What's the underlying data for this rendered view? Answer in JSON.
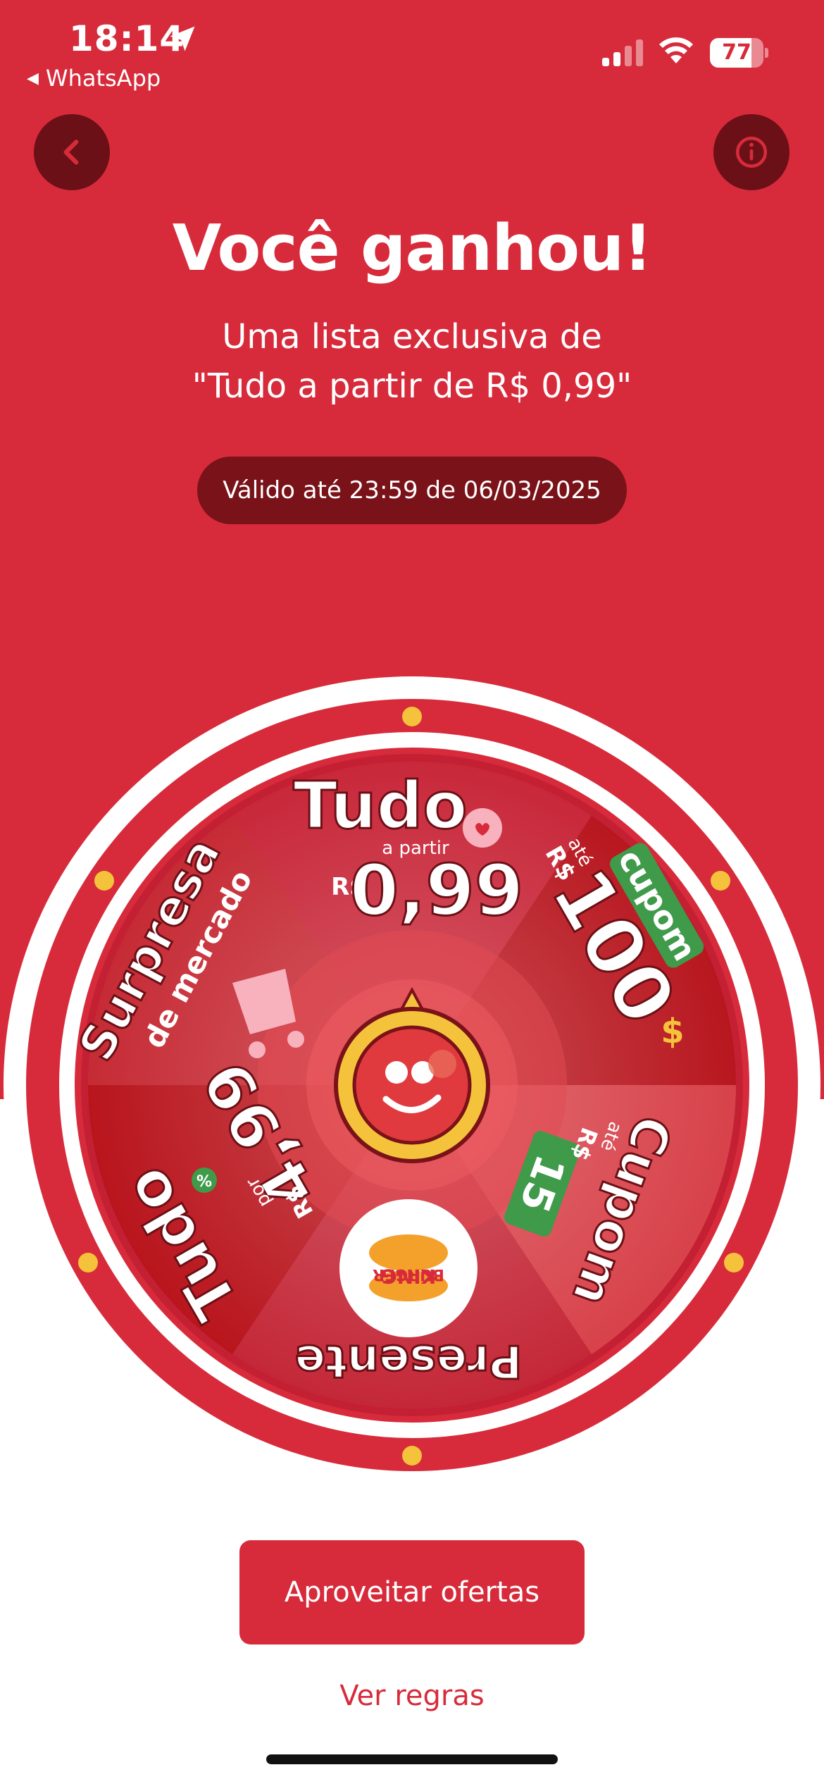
{
  "status_bar": {
    "time": "18:14",
    "back_app": "WhatsApp",
    "battery": "77",
    "battery_level": 0.77
  },
  "header": {
    "headline": "Você ganhou!",
    "subtitle_line1": "Uma lista exclusiva de",
    "subtitle_line2": "\"Tudo a partir de R$ 0,99\"",
    "validity": "Válido até 23:59 de 06/03/2025"
  },
  "wheel": {
    "segments": [
      {
        "title": "Tudo",
        "sub": "a partir",
        "prefix": "R$",
        "value": "0,99"
      },
      {
        "badge": "cupom",
        "sub": "até",
        "prefix": "R$",
        "value": "100"
      },
      {
        "title": "Cupom",
        "sub": "até",
        "prefix": "R$",
        "value": "15"
      },
      {
        "title": "Presente",
        "logo_top": "BURGER",
        "logo_bottom": "KING"
      },
      {
        "title": "Tudo",
        "sub": "por",
        "prefix": "R$",
        "value": "4,99"
      },
      {
        "title": "Surpresa",
        "sub": "de mercado"
      }
    ]
  },
  "actions": {
    "primary": "Aproveitar ofertas",
    "secondary": "Ver regras"
  },
  "colors": {
    "brand": "#d72b3b",
    "dark": "#7a1219",
    "green": "#3f9a4a",
    "gold": "#f5c33b"
  },
  "icons": [
    "location-arrow-icon",
    "signal-icon",
    "wifi-icon",
    "battery-icon",
    "back-chevron-icon",
    "info-icon",
    "mascot-icon",
    "shopping-cart-icon",
    "hearts-icon",
    "burger-king-logo"
  ]
}
